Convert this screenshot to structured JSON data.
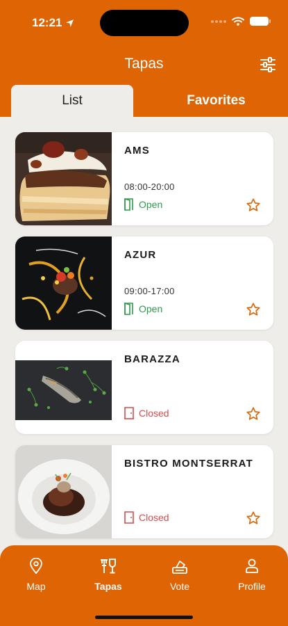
{
  "status": {
    "time": "12:21"
  },
  "header": {
    "title": "Tapas"
  },
  "tabs": [
    {
      "label": "List",
      "active": true
    },
    {
      "label": "Favorites",
      "active": false
    }
  ],
  "colors": {
    "brand": "#de6404",
    "open": "#2e9a4a",
    "closed": "#d84a4a",
    "background": "#efedea"
  },
  "restaurants": [
    {
      "name": "AMS",
      "hours": "08:00-20:00",
      "status": "Open",
      "image": "puff-pastry-tapa"
    },
    {
      "name": "AZUR",
      "hours": "09:00-17:00",
      "status": "Open",
      "image": "plated-tapa-dark"
    },
    {
      "name": "BARAZZA",
      "hours": "",
      "status": "Closed",
      "image": "sardine-on-slate"
    },
    {
      "name": "BISTRO MONTSERRAT",
      "hours": "",
      "status": "Closed",
      "image": "stew-white-bowl"
    }
  ],
  "nav": [
    {
      "label": "Map",
      "icon": "map-pin-icon",
      "active": false
    },
    {
      "label": "Tapas",
      "icon": "tapas-icon",
      "active": true
    },
    {
      "label": "Vote",
      "icon": "vote-icon",
      "active": false
    },
    {
      "label": "Profile",
      "icon": "profile-icon",
      "active": false
    }
  ]
}
